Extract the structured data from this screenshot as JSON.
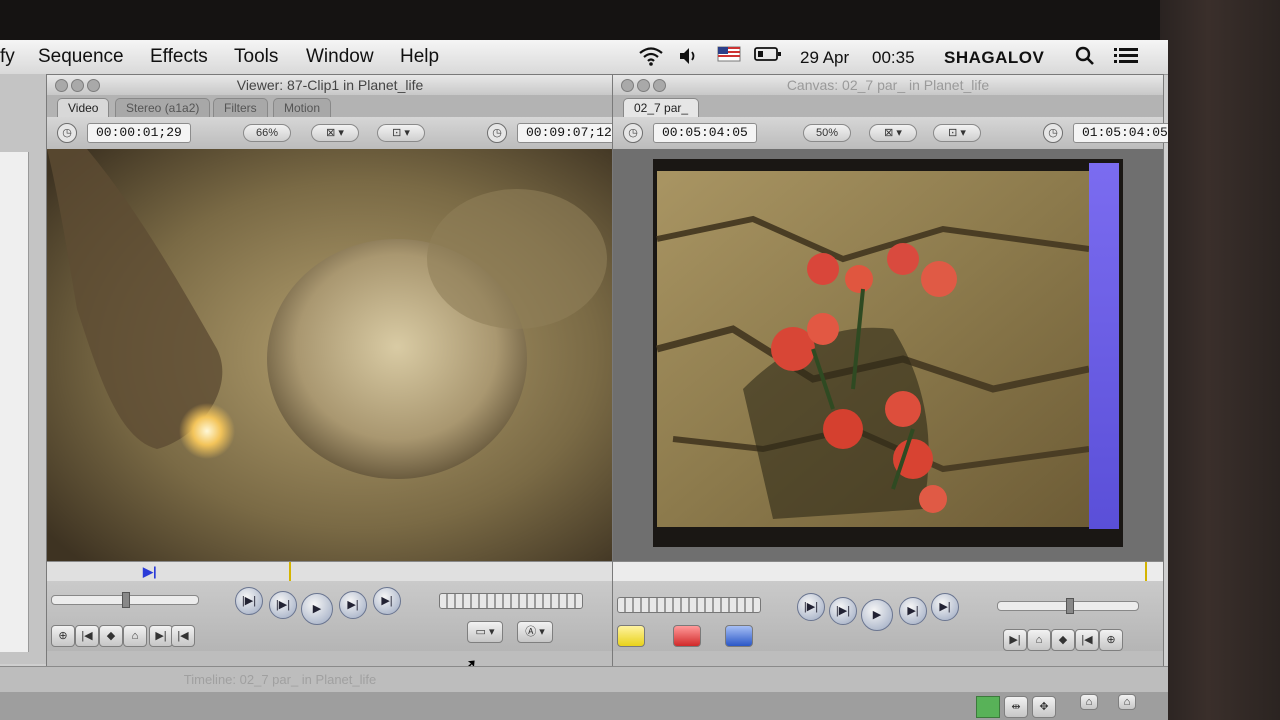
{
  "menubar": {
    "items": [
      "fy",
      "Sequence",
      "Effects",
      "Tools",
      "Window",
      "Help"
    ],
    "date": "29 Apr",
    "time": "00:35",
    "user": "SHAGALOV",
    "icons": [
      "wifi-icon",
      "volume-icon",
      "flag-icon",
      "battery-icon",
      "search-icon",
      "list-icon"
    ]
  },
  "viewer": {
    "title": "Viewer: 87-Clip1 in Planet_life",
    "tabs": [
      "Video",
      "Stereo (a1a2)",
      "Filters",
      "Motion"
    ],
    "timecode_duration": "00:00:01;29",
    "zoom": "66%",
    "timecode_current": "00:09:07;12"
  },
  "canvas": {
    "title": "Canvas: 02_7 par_ in Planet_life",
    "tab": "02_7 par_",
    "timecode_duration": "00:05:04:05",
    "zoom": "50%",
    "timecode_current": "01:05:04:05"
  },
  "timeline": {
    "title": "Timeline: 02_7 par_ in Planet_life"
  },
  "colors": {
    "overwrite": "#e8d21a",
    "replace": "#d12a2a",
    "insert": "#2a57c7"
  }
}
